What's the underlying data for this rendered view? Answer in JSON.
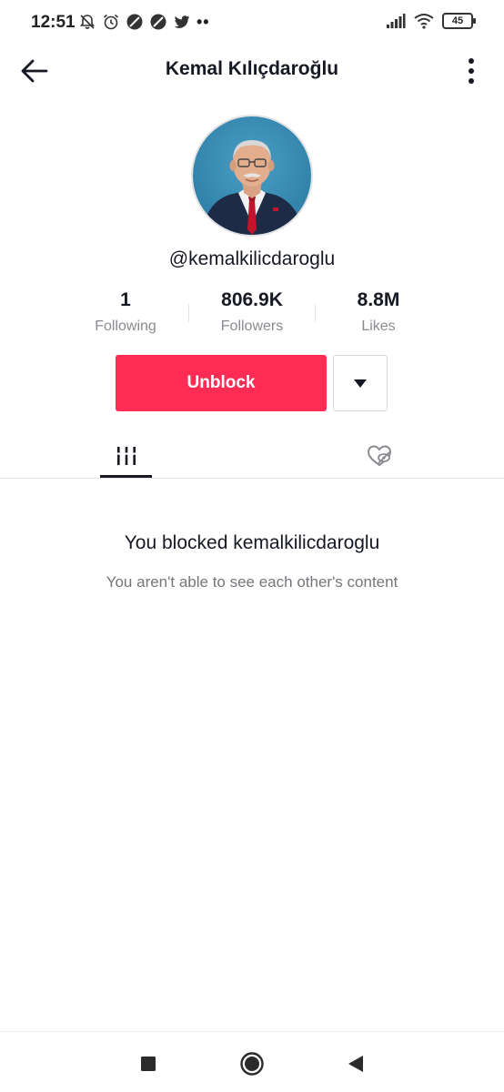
{
  "status_bar": {
    "time": "12:51",
    "battery": "45",
    "icons_left": [
      "bell-off-icon",
      "alarm-icon",
      "vpn-icon",
      "vpn-icon",
      "twitter-icon"
    ],
    "overflow": "••",
    "icons_right": [
      "signal-icon",
      "wifi-icon",
      "battery-icon"
    ]
  },
  "header": {
    "title": "Kemal Kılıçdaroğlu",
    "back_icon": "arrow-left-icon",
    "more_icon": "more-vertical-icon"
  },
  "profile": {
    "username": "@kemalkilicdaroglu",
    "avatar_icon": "profile-photo"
  },
  "stats": [
    {
      "value": "1",
      "label": "Following"
    },
    {
      "value": "806.9K",
      "label": "Followers"
    },
    {
      "value": "8.8M",
      "label": "Likes"
    }
  ],
  "actions": {
    "unblock_label": "Unblock",
    "dropdown_icon": "caret-down-icon"
  },
  "tabs": [
    {
      "name": "videos",
      "icon": "grid-lines-icon",
      "active": true
    },
    {
      "name": "liked",
      "icon": "heart-hidden-icon",
      "active": false
    }
  ],
  "blocked": {
    "title": "You blocked kemalkilicdaroglu",
    "subtitle": "You aren't able to see each other's content"
  },
  "system_nav": [
    "recents-icon",
    "home-icon",
    "back-icon"
  ],
  "colors": {
    "accent": "#fe2c55",
    "text_primary": "#161823",
    "text_secondary": "#8a8b91"
  }
}
